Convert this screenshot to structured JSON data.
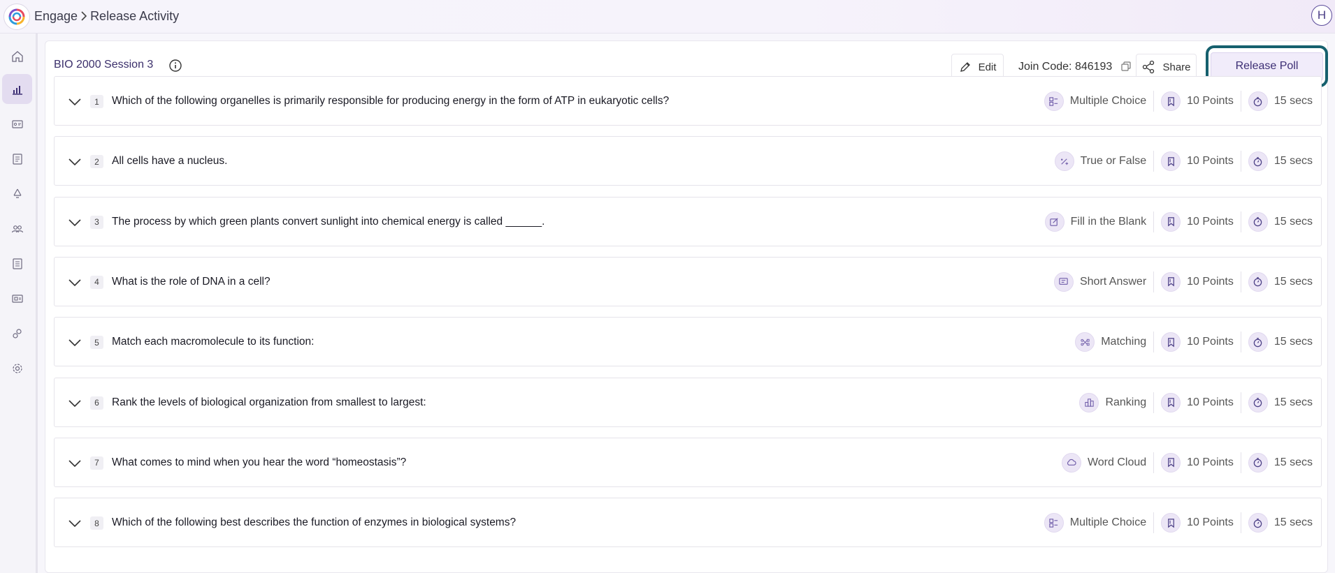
{
  "breadcrumb": {
    "app": "Engage",
    "page": "Release Activity"
  },
  "user": {
    "initial": "H"
  },
  "sidebar": {
    "items": [
      {
        "icon": "home-icon"
      },
      {
        "icon": "analytics-icon",
        "active": true
      },
      {
        "icon": "id-card-icon"
      },
      {
        "icon": "document-icon"
      },
      {
        "icon": "recycle-icon"
      },
      {
        "icon": "users-icon"
      },
      {
        "icon": "list-icon"
      },
      {
        "icon": "gallery-icon"
      },
      {
        "icon": "integrations-icon"
      },
      {
        "icon": "settings-icon"
      }
    ]
  },
  "header": {
    "session_title": "BIO 2000 Session 3",
    "edit_label": "Edit",
    "join_code_label": "Join Code: 846193",
    "share_label": "Share",
    "release_label": "Release Poll"
  },
  "colors": {
    "accent": "#3c2e74",
    "highlight_border": "#16606e",
    "icon_bg": "#ece6f6"
  },
  "questions": [
    {
      "num": "1",
      "text": "Which of the following organelles is primarily responsible for producing energy in the form of ATP in eukaryotic cells?",
      "type": "Multiple Choice",
      "type_icon": "multiple-choice-icon",
      "points": "10 Points",
      "time": "15 secs"
    },
    {
      "num": "2",
      "text": "All cells have a nucleus.",
      "type": "True or False",
      "type_icon": "true-false-icon",
      "points": "10 Points",
      "time": "15 secs"
    },
    {
      "num": "3",
      "text": "The process by which green plants convert sunlight into chemical energy is called ______.",
      "type": "Fill in the Blank",
      "type_icon": "fill-blank-icon",
      "points": "10 Points",
      "time": "15 secs"
    },
    {
      "num": "4",
      "text": "What is the role of DNA in a cell?",
      "type": "Short Answer",
      "type_icon": "short-answer-icon",
      "points": "10 Points",
      "time": "15 secs"
    },
    {
      "num": "5",
      "text": "Match each macromolecule to its function:",
      "type": "Matching",
      "type_icon": "matching-icon",
      "points": "10 Points",
      "time": "15 secs"
    },
    {
      "num": "6",
      "text": "Rank the levels of biological organization from smallest to largest:",
      "type": "Ranking",
      "type_icon": "ranking-icon",
      "points": "10 Points",
      "time": "15 secs"
    },
    {
      "num": "7",
      "text": "What comes to mind when you hear the word “homeostasis”?",
      "type": "Word Cloud",
      "type_icon": "word-cloud-icon",
      "points": "10 Points",
      "time": "15 secs"
    },
    {
      "num": "8",
      "text": "Which of the following best describes the function of enzymes in biological systems?",
      "type": "Multiple Choice",
      "type_icon": "multiple-choice-icon",
      "points": "10 Points",
      "time": "15 secs"
    }
  ]
}
